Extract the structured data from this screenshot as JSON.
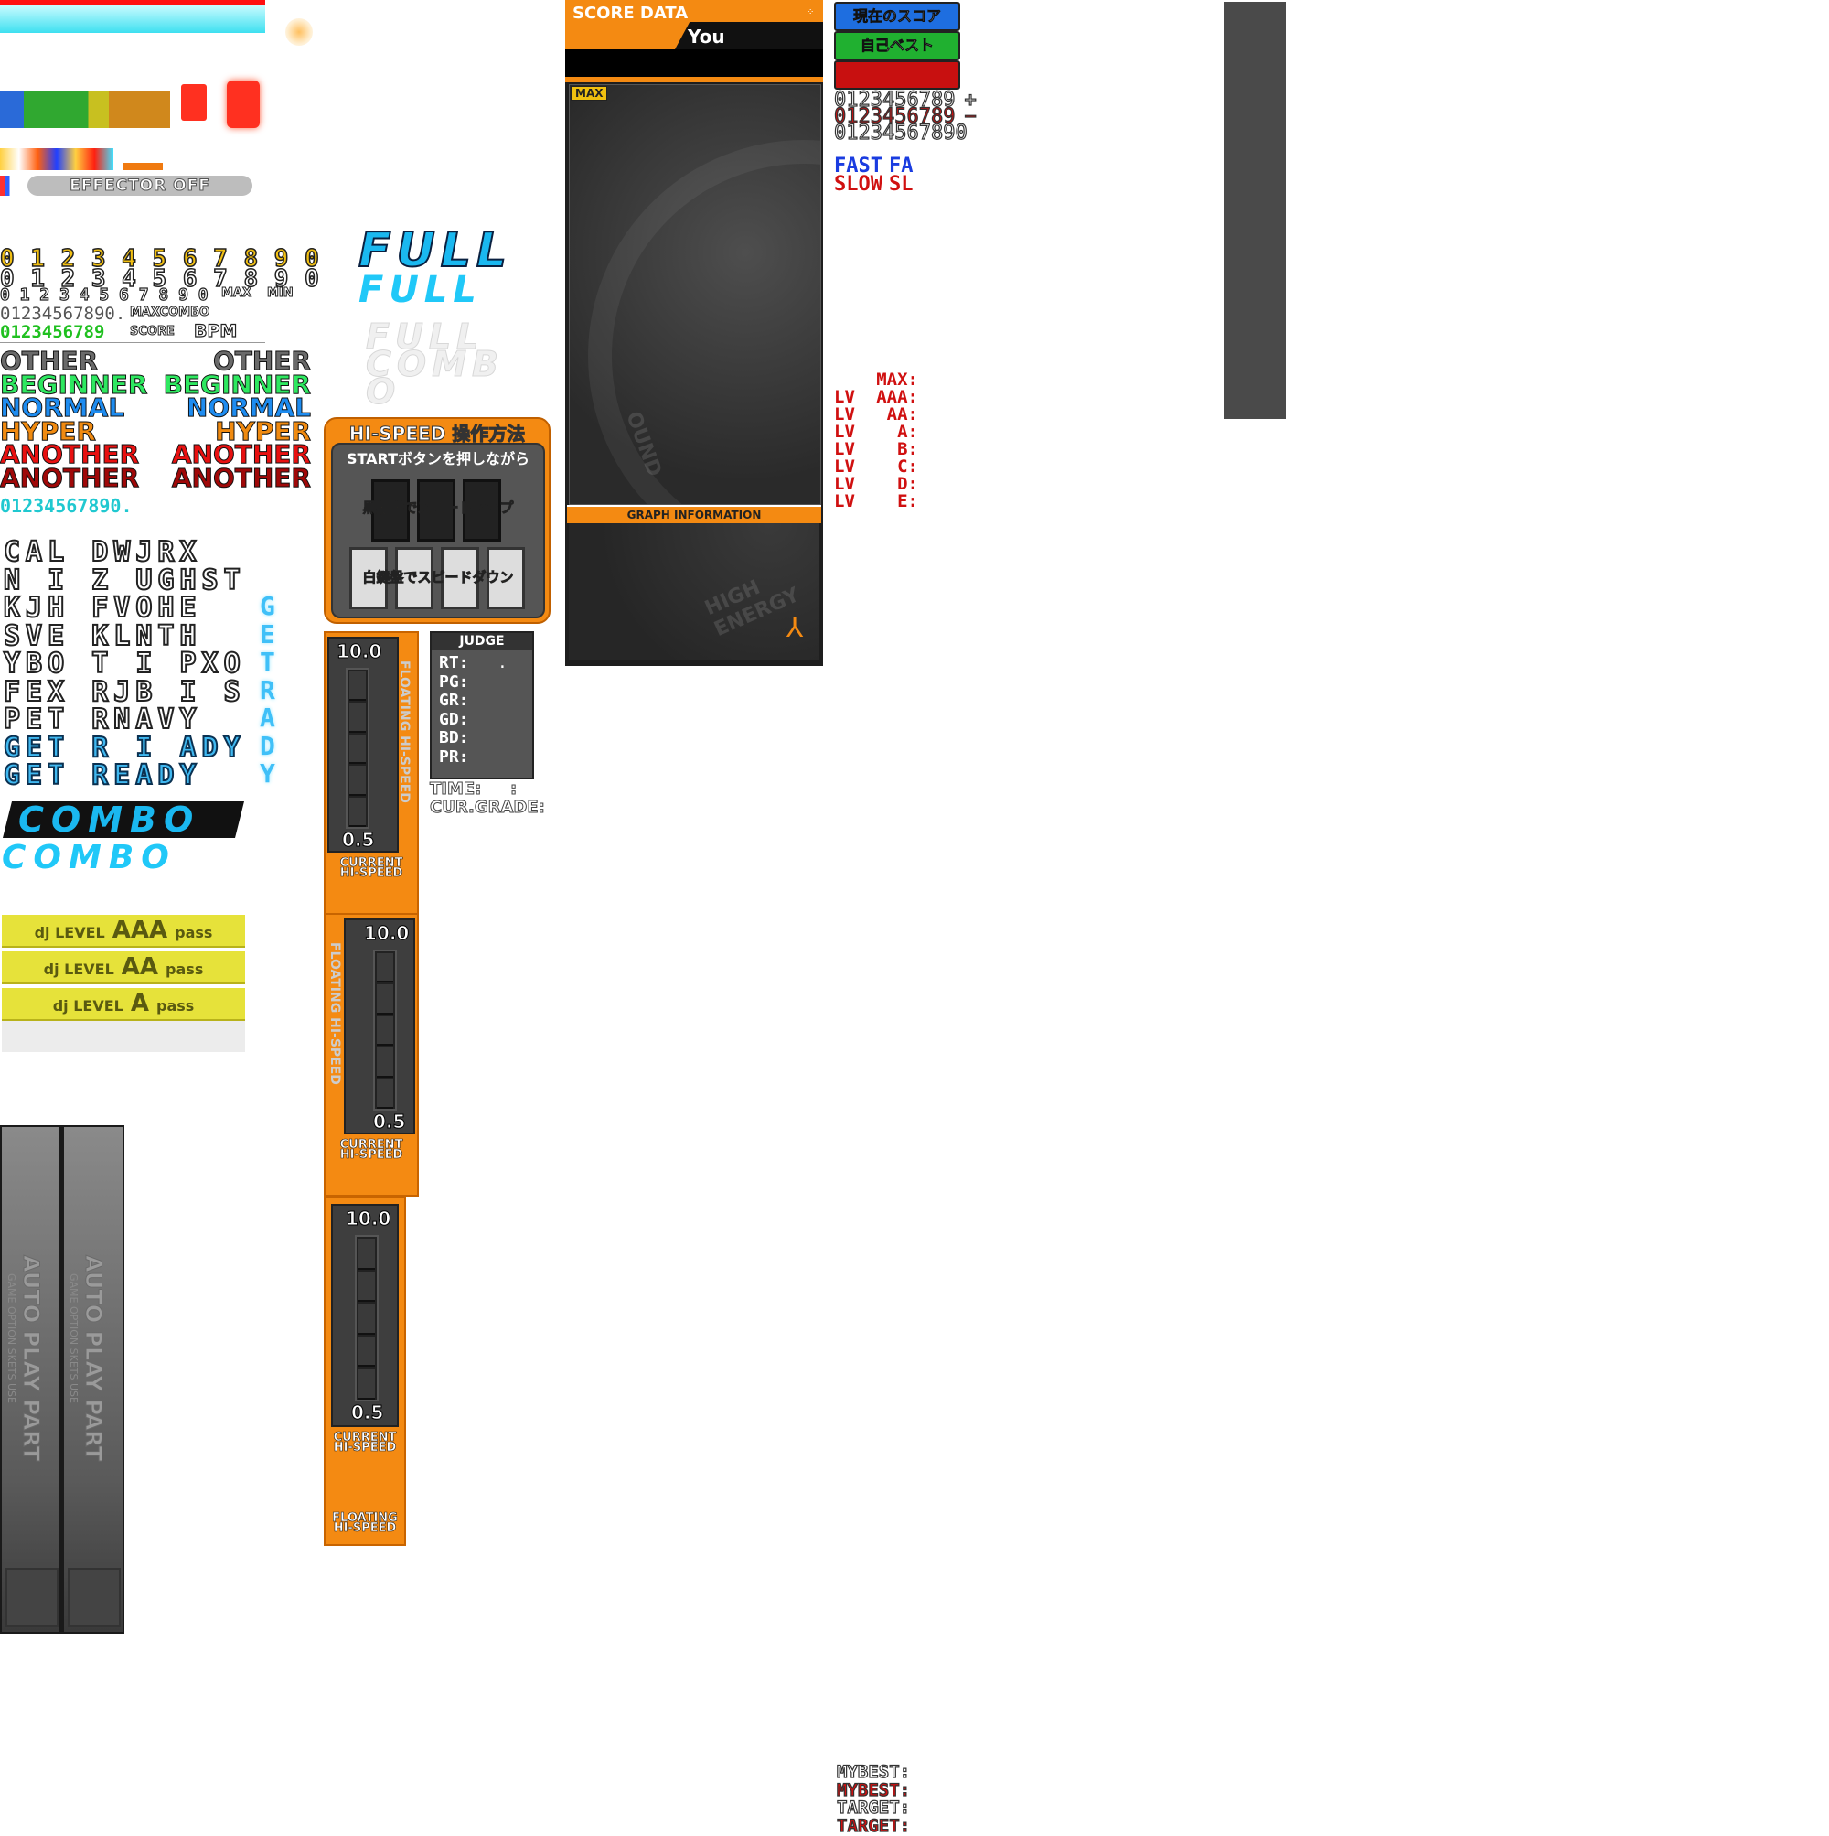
{
  "effector_label": "EFFECTOR OFF",
  "digits": {
    "yellow": "0 1 2 3 4 5 6 7 8 9 0",
    "white": "0 1 2 3 4 5 6 7 8 9 0",
    "small": "0 1 2 3 4 5 6 7 8 9 0",
    "max_label": "MAX",
    "min_label": "MIN",
    "plain": "01234567890.",
    "maxcombo_label": "MAXCOMBO",
    "green": "0123456789",
    "score_label": "SCORE",
    "bpm_label": "BPM",
    "cyan": "01234567890."
  },
  "difficulties": [
    {
      "left": "OTHER",
      "right": "OTHER",
      "color": "#6a6a6a"
    },
    {
      "left": "BEGINNER",
      "right": "BEGINNER",
      "color": "#2ee860"
    },
    {
      "left": "NORMAL",
      "right": "NORMAL",
      "color": "#1e8cf0"
    },
    {
      "left": "HYPER",
      "right": "HYPER",
      "color": "#f08a10"
    },
    {
      "left": "ANOTHER",
      "right": "ANOTHER",
      "color": "#e81010"
    },
    {
      "left": "ANOTHER",
      "right": "ANOTHER",
      "color": "#a00808"
    }
  ],
  "glyph_lines": [
    "CAL DWJRX",
    "N I Z UGHST",
    "KJH FVOHE",
    "SVE KLNTH",
    "YBO T I PXO",
    "FEX RJB I S",
    "PET RNAVY",
    "GET R I ADY",
    "GET READY"
  ],
  "get_ready_column": [
    "G",
    "E",
    "T",
    "R",
    "A",
    "D",
    "Y"
  ],
  "full": [
    "FULL",
    "FULL"
  ],
  "full_combo_ghost": [
    "FULL",
    "COMB",
    "O"
  ],
  "combo": [
    "COMBO",
    "COMBO"
  ],
  "hispeed_help": {
    "title": "HI-SPEED 操作方法",
    "subtitle": "STARTボタンを押しながら",
    "up_label": "黒鍵盤でスピードアップ",
    "down_label": "白鍵盤でスピードダウン"
  },
  "floating": {
    "max": "10.0",
    "min": "0.5",
    "vertical_label": "FLOATING HI-SPEED",
    "current_label_1": "CURRENT",
    "current_label_2": "HI-SPEED",
    "floating_label_1": "FLOATING",
    "floating_label_2": "HI-SPEED"
  },
  "judge": {
    "title": "JUDGE",
    "rows": [
      "RT:",
      "PG:",
      "GR:",
      "GD:",
      "BD:",
      "PR:"
    ],
    "dot": ".",
    "time": "TIME:",
    "colon": ":",
    "grade": "CUR.GRADE:"
  },
  "dj_level": [
    {
      "prefix": "dj LEVEL",
      "grade": "AAA",
      "suffix": "pass"
    },
    {
      "prefix": "dj LEVEL",
      "grade": "AA",
      "suffix": "pass"
    },
    {
      "prefix": "dj LEVEL",
      "grade": "A",
      "suffix": "pass"
    }
  ],
  "auto_play": {
    "title": "AUTO PLAY PART",
    "subtitle": "GAME OPTION SKETS USE"
  },
  "score_data": {
    "header": "SCORE DATA",
    "you": "You",
    "max_tag": "MAX",
    "graph_info": "GRAPH INFORMATION",
    "bg_text_1": "HIGH ENERGY",
    "bg_text_2": "OUND"
  },
  "score_buttons": [
    {
      "label": "現在のスコア",
      "color": "#1e6ee0"
    },
    {
      "label": "自己ベスト",
      "color": "#20b030"
    },
    {
      "label": "",
      "color": "#c81010"
    }
  ],
  "score_digits": [
    {
      "text": "0123456789",
      "sign": "+",
      "color": "#ffffff"
    },
    {
      "text": "0123456789",
      "sign": "−",
      "color": "#d01010"
    },
    {
      "text": "01234567890",
      "sign": "",
      "color": "#ffffff"
    }
  ],
  "timing": {
    "fast": "FAST",
    "fast_short": "FA",
    "slow": "SLOW",
    "slow_short": "SL",
    "fast_color": "#1a3ce0",
    "slow_color": "#d01010"
  },
  "lv_rows": [
    {
      "left": "",
      "right": "MAX:"
    },
    {
      "left": "LV",
      "right": "AAA:"
    },
    {
      "left": "LV",
      "right": "AA:"
    },
    {
      "left": "LV",
      "right": "A:"
    },
    {
      "left": "LV",
      "right": "B:"
    },
    {
      "left": "LV",
      "right": "C:"
    },
    {
      "left": "LV",
      "right": "D:"
    },
    {
      "left": "LV",
      "right": "E:"
    }
  ],
  "target_rows": [
    {
      "label": "MYBEST:",
      "color": "#ffffff"
    },
    {
      "label": "MYBEST:",
      "color": "#d01010"
    },
    {
      "label": "TARGET:",
      "color": "#ffffff"
    },
    {
      "label": "TARGET:",
      "color": "#d01010"
    }
  ]
}
